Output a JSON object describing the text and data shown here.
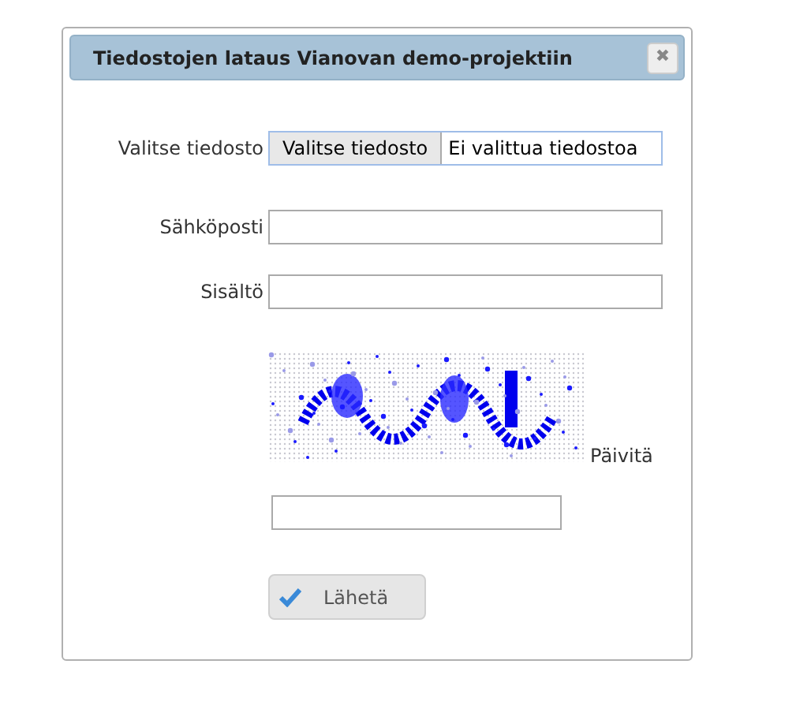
{
  "dialog": {
    "title": "Tiedostojen lataus Vianovan demo-projektiin",
    "close_icon": "✖"
  },
  "file": {
    "label": "Valitse tiedosto",
    "button": "Valitse tiedosto",
    "status": "Ei valittua tiedostoa"
  },
  "fields": [
    {
      "label": "Sähköposti"
    },
    {
      "label": "Sisältö"
    }
  ],
  "captcha": {
    "refresh": "Päivitä"
  },
  "submit": "Lähetä"
}
